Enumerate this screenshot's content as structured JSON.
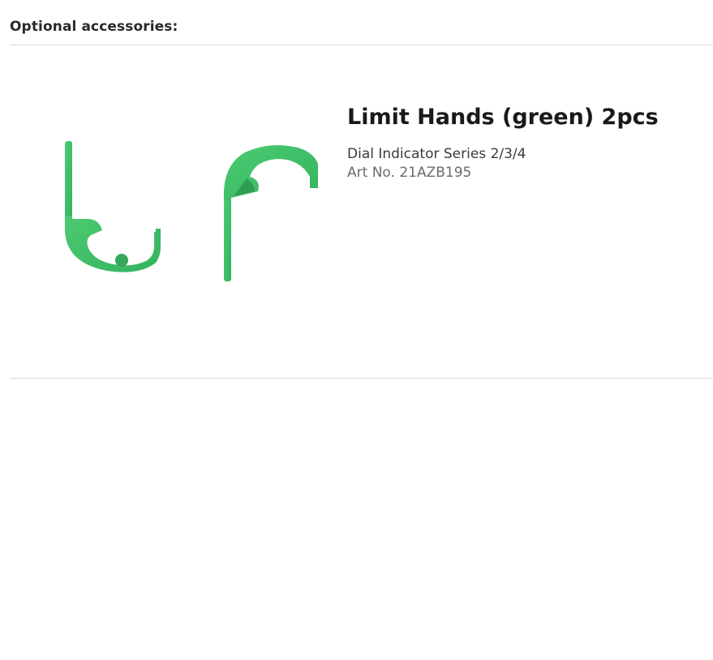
{
  "section": {
    "title": "Optional accessories:"
  },
  "product": {
    "name": "Limit Hands (green) 2pcs",
    "series": "Dial Indicator Series 2/3/4",
    "article_number": "Art No. 21AZB195",
    "image": {
      "icon": "limit-hands-image",
      "color": "#3fbf6a"
    }
  },
  "colors": {
    "divider": "#d9d9d9",
    "text_primary": "#1a1a1a",
    "text_secondary": "#6b6b6b",
    "accent_green": "#3fbf6a"
  }
}
